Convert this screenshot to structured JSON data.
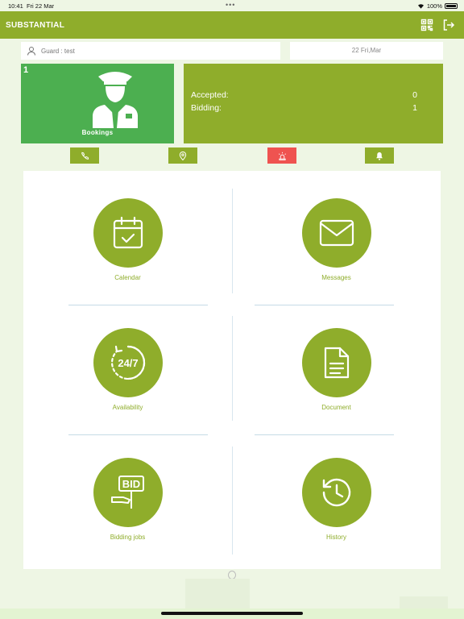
{
  "status_bar": {
    "time": "10:41",
    "date": "Fri 22 Mar",
    "battery": "100%"
  },
  "app": {
    "title": "SUBSTANTIAL",
    "accent_color": "#8fad2b",
    "qr_icon": "qr-code-icon",
    "logout_icon": "logout-icon"
  },
  "user": {
    "guard_label": "Guard : test",
    "date": "22 Fri,Mar"
  },
  "bookings": {
    "count": "1",
    "label": "Bookings",
    "color": "#4caf50"
  },
  "stats": [
    {
      "label": "Accepted:",
      "value": "0"
    },
    {
      "label": "Bidding:",
      "value": "1"
    }
  ],
  "actions": [
    {
      "name": "phone",
      "icon": "phone-icon"
    },
    {
      "name": "location",
      "icon": "location-pin-icon"
    },
    {
      "name": "alarm",
      "icon": "siren-icon",
      "color": "#ef5350"
    },
    {
      "name": "notifications",
      "icon": "bell-icon"
    }
  ],
  "menu": [
    {
      "label": "Calendar",
      "icon": "calendar-check-icon"
    },
    {
      "label": "Messages",
      "icon": "envelope-icon"
    },
    {
      "label": "Availability",
      "icon": "availability-24-7-icon",
      "icon_text": "24/7"
    },
    {
      "label": "Document",
      "icon": "document-icon"
    },
    {
      "label": "Bidding jobs",
      "icon": "bid-sign-icon",
      "icon_text": "BID"
    },
    {
      "label": "History",
      "icon": "history-icon"
    }
  ]
}
